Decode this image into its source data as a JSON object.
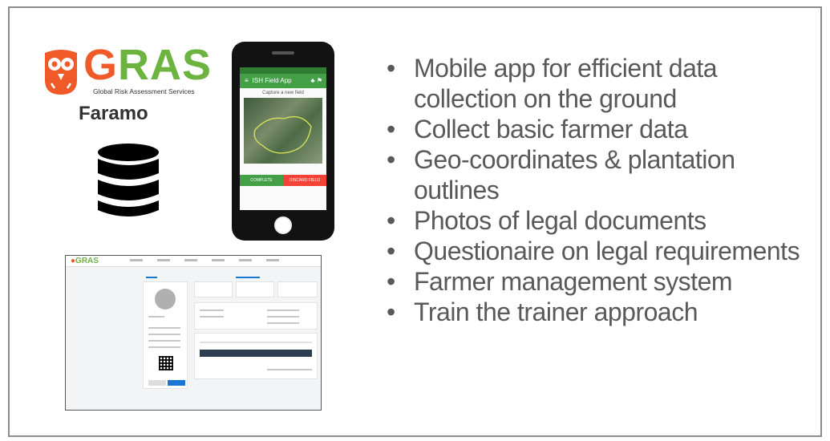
{
  "logo": {
    "brand_letters": [
      "G",
      "R",
      "A",
      "S"
    ],
    "tagline": "Global Risk Assessment Services",
    "product": "Faramo",
    "colors": {
      "orange": "#f05a28",
      "green": "#6cb33f"
    }
  },
  "icons": {
    "database": "database-icon",
    "owl": "owl-icon"
  },
  "phone_app": {
    "title": "ISH Field App",
    "screen_title": "Capture a new field",
    "buttons": {
      "complete": "COMPLETE",
      "discard": "DISCARD FIELD"
    }
  },
  "desktop_app": {
    "logo": "GRAS"
  },
  "bullets": [
    "Mobile app for efficient data collection on the ground",
    "Collect basic farmer data",
    "Geo-coordinates & plantation outlines",
    "Photos of legal documents",
    "Questionaire on legal requirements",
    "Farmer management system",
    "Train the trainer approach"
  ]
}
